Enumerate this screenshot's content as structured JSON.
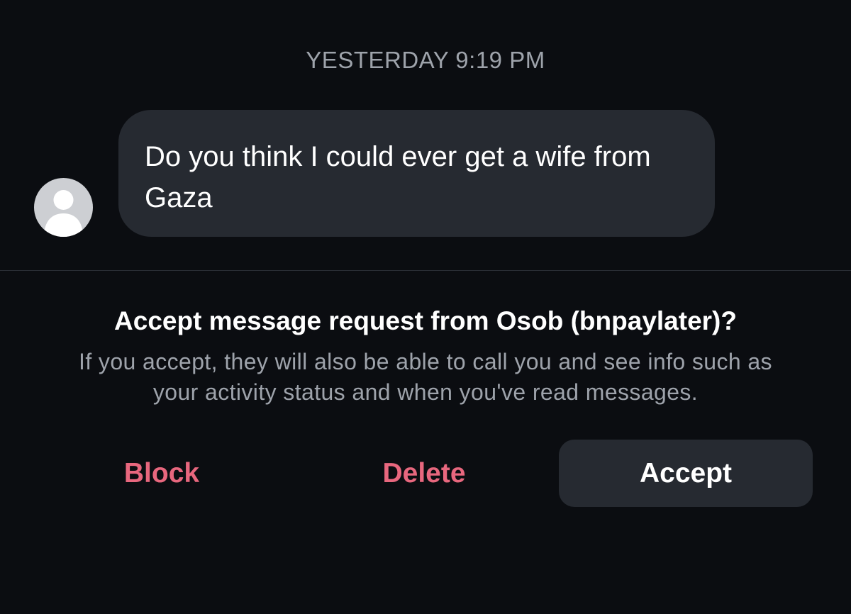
{
  "conversation": {
    "timestamp": "YESTERDAY 9:19 PM",
    "message": {
      "text": "Do you think I could ever get a wife from Gaza",
      "avatar_icon": "default-person-icon"
    }
  },
  "request": {
    "title": "Accept message request from Osob (bnpaylater)?",
    "description": "If you accept, they will also be able to call you and see info such as your activity status and when you've read messages."
  },
  "actions": {
    "block_label": "Block",
    "delete_label": "Delete",
    "accept_label": "Accept"
  },
  "colors": {
    "background": "#0b0d11",
    "bubble": "#262a31",
    "destructive": "#e8677e",
    "secondary_text": "#9ea3ab"
  }
}
